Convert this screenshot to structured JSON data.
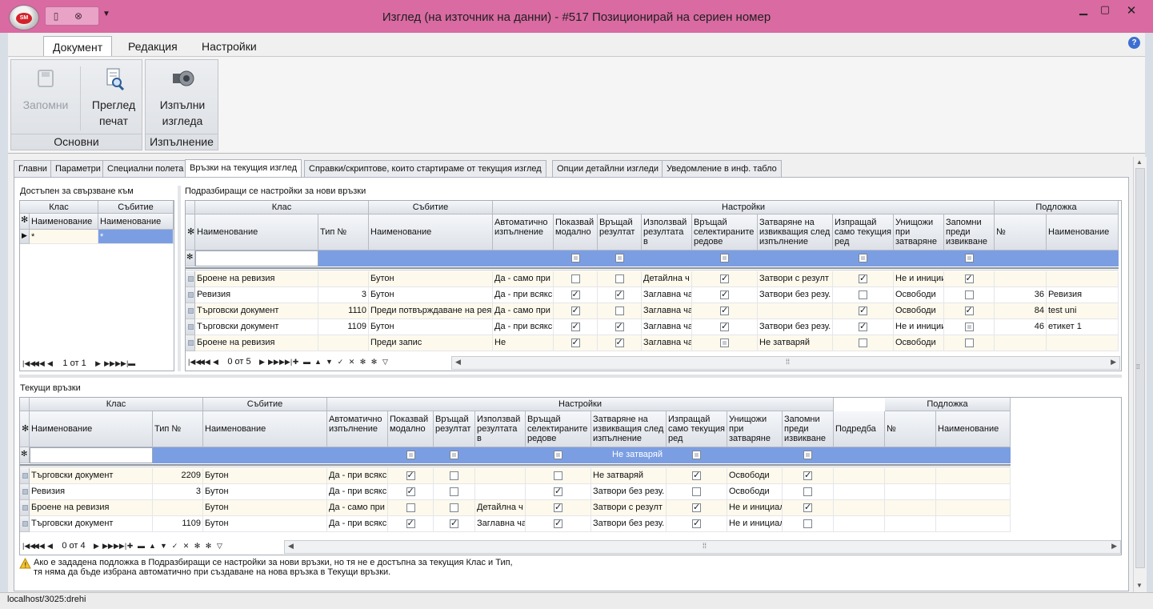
{
  "window": {
    "title": "Изглед (на източник на данни) - #517 Позиционирай на сериен номер",
    "logo_text": "SM"
  },
  "ribbon": {
    "tabs": [
      "Документ",
      "Редакция",
      "Настройки"
    ],
    "save_label": "Запомни",
    "print_label": "Преглед печат",
    "execute_label": "Изпълни изгледа",
    "group_main": "Основни",
    "group_exec": "Изпълнение"
  },
  "page_tabs": [
    "Главни",
    "Параметри",
    "Специални полета",
    "Връзки на текущия изглед",
    "Справки/скриптове, които стартираме от текущия изглед",
    "Опции детайлни изгледи",
    "Уведомление в инф. табло"
  ],
  "left": {
    "title": "Достъпен за свързване към",
    "hdr_class": "Клас",
    "hdr_event": "Събитие",
    "hdr_name1": "Наименование",
    "hdr_name2": "Наименование",
    "new_cell1": "*",
    "new_cell2": "*",
    "nav": "1 от 1"
  },
  "top": {
    "title": "Подразбиращи се настройки за нови връзки",
    "grp_class": "Клас",
    "grp_event": "Събитие",
    "grp_settings": "Настройки",
    "grp_template": "Подложка",
    "cols": [
      "Наименование",
      "Тип №",
      "Наименование",
      "Автоматично изпълнение",
      "Показвай модално",
      "Връщай резултат",
      "Използвай резултата в",
      "Връщай селектираните редове",
      "Затваряне на извикващия след изпълнение",
      "Изпращай само текущия ред",
      "Унищожи при затваряне",
      "Запомни преди извикване",
      "№",
      "Наименование"
    ],
    "rows": [
      [
        "Броене на ревизия",
        "",
        "Бутон",
        "Да - само при",
        "u",
        "u",
        "Детайлна ч",
        "c",
        "Затвори с резулт",
        "c",
        "Не и иницииа",
        "c",
        "",
        ""
      ],
      [
        "Ревизия",
        "3",
        "Бутон",
        "Да - при всякс",
        "c",
        "c",
        "Заглавна ча",
        "c",
        "Затвори без резу.",
        "u",
        "Освободи",
        "u",
        "36",
        "Ревизия"
      ],
      [
        "Търговски документ",
        "1110",
        "Преди потвърждаване на рея",
        "Да - само при",
        "c",
        "u",
        "Заглавна ча",
        "c",
        "",
        "c",
        "Освободи",
        "c",
        "84",
        "test uni"
      ],
      [
        "Търговски документ",
        "1109",
        "Бутон",
        "Да - при всякс",
        "c",
        "c",
        "Заглавна ча",
        "c",
        "Затвори без резу.",
        "c",
        "Не и иницииа",
        "i",
        "46",
        "етикет 1"
      ],
      [
        "Броене на ревизия",
        "",
        "Преди запис",
        "Не",
        "c",
        "c",
        "Заглавна ча",
        "i",
        "Не затваряй",
        "u",
        "Освободи",
        "u",
        "",
        ""
      ]
    ],
    "nav": "0 от 5"
  },
  "bottom": {
    "title": "Текущи връзки",
    "grp_class": "Клас",
    "grp_event": "Събитие",
    "grp_settings": "Настройки",
    "grp_template": "Подложка",
    "cols": [
      "Наименование",
      "Тип №",
      "Наименование",
      "Автоматично изпълнение",
      "Показвай модално",
      "Връщай резултат",
      "Използвай резултата в",
      "Връщай селектираните редове",
      "Затваряне на извикващия след изпълнение",
      "Изпращай само текущия ред",
      "Унищожи при затваряне",
      "Запомни преди извикване",
      "Подредба",
      "№",
      "Наименование"
    ],
    "filter_text": "Не затваряй",
    "rows": [
      [
        "Търговски документ",
        "2209",
        "Бутон",
        "Да - при всякс",
        "c",
        "u",
        "",
        "u",
        "Не затваряй",
        "c",
        "Освободи",
        "c",
        "",
        "",
        ""
      ],
      [
        "Ревизия",
        "3",
        "Бутон",
        "Да - при всякс",
        "c",
        "u",
        "",
        "c",
        "Затвори без резу.",
        "u",
        "Освободи",
        "u",
        "",
        "",
        ""
      ],
      [
        "Броене на ревизия",
        "",
        "Бутон",
        "Да - само при",
        "u",
        "u",
        "Детайлна ч",
        "c",
        "Затвори с резулт",
        "c",
        "Не и инициал",
        "c",
        "",
        "",
        ""
      ],
      [
        "Търговски документ",
        "1109",
        "Бутон",
        "Да - при всякс",
        "c",
        "c",
        "Заглавна ча",
        "c",
        "Затвори без резу.",
        "c",
        "Не и инициал",
        "u",
        "",
        "",
        ""
      ]
    ],
    "nav": "0 от 4"
  },
  "warning": "Ако е зададена подложка в Подразбиращи се настройки за нови връзки, но тя не е достъпна за текущия Клас и Тип, тя няма да бъде избрана автоматично при създаване на нова връзка в Текущи връзки.",
  "warning_line1": "Ако е зададена подложка в Подразбиращи се настройки за нови връзки, но тя не е достъпна за текущия Клас и Тип,",
  "warning_line2": "тя няма да бъде избрана автоматично при създаване на нова връзка в Текущи връзки.",
  "status": "localhost/3025:drehi"
}
